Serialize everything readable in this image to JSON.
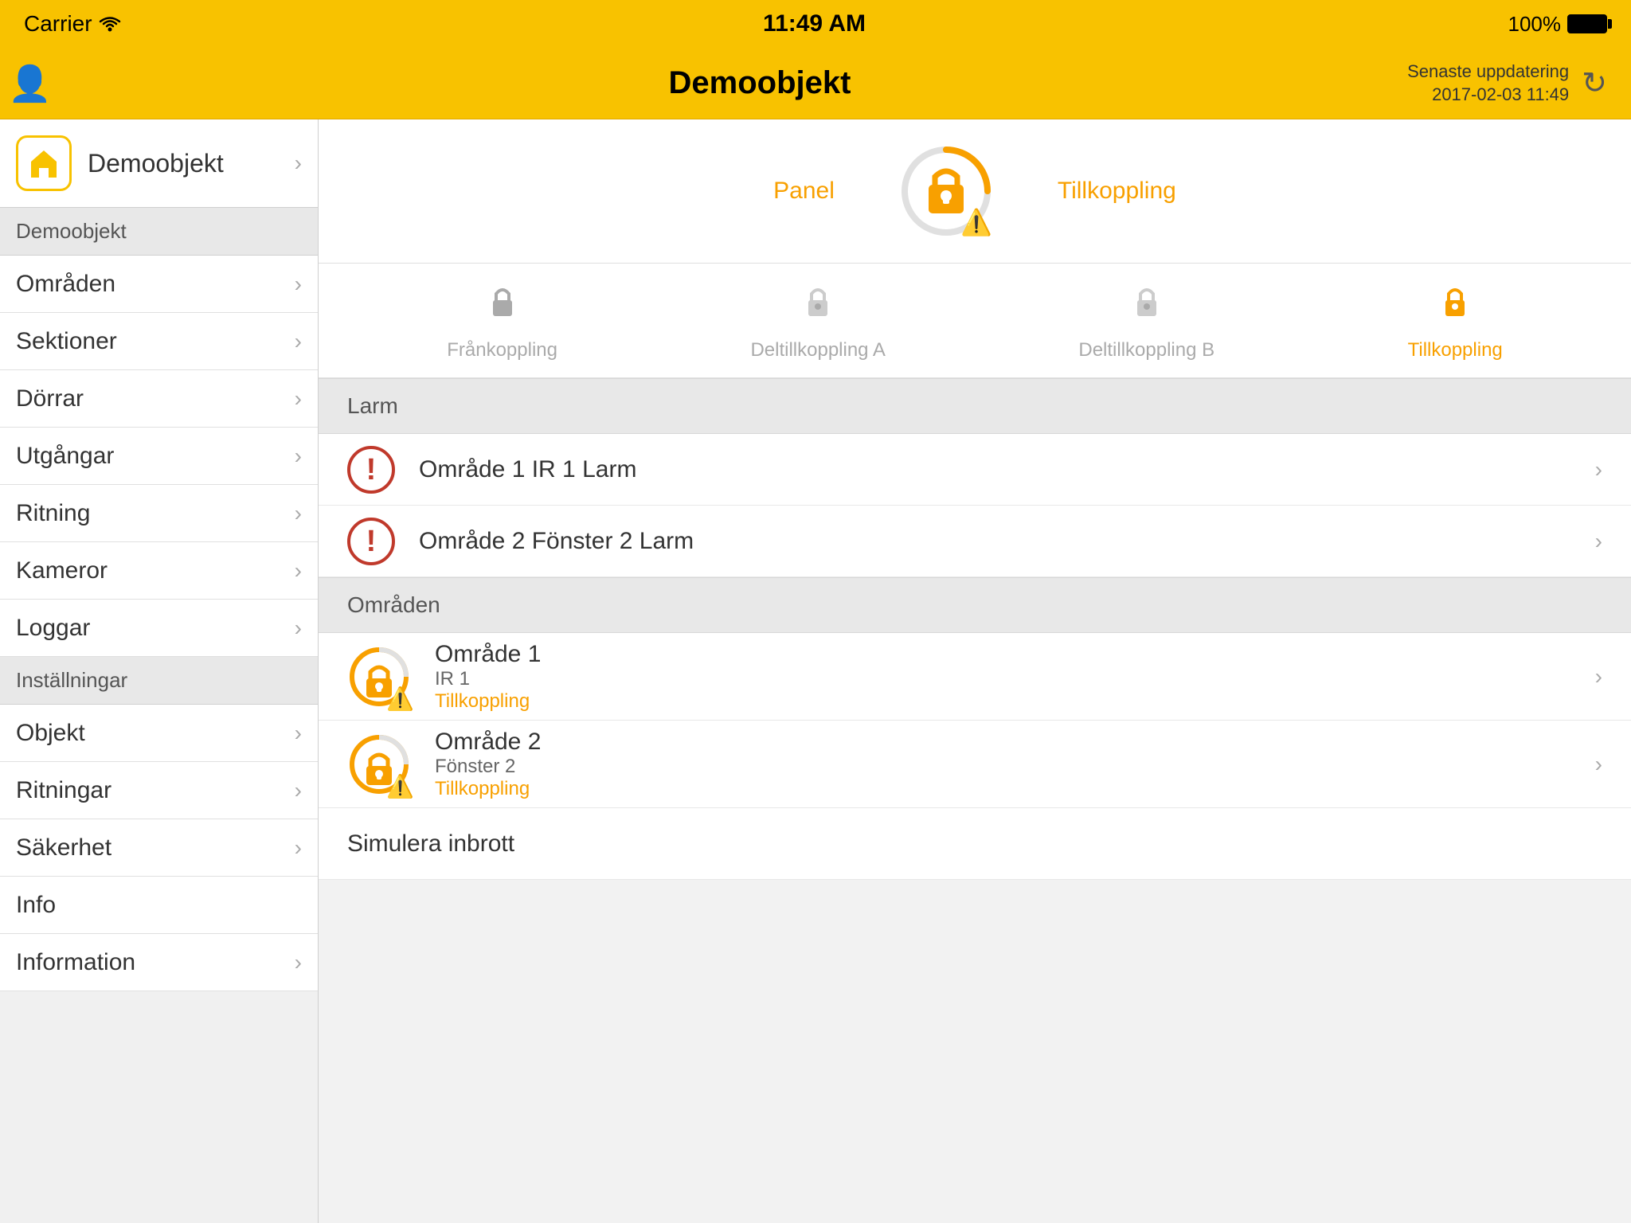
{
  "statusBar": {
    "carrier": "Carrier",
    "time": "11:49 AM",
    "battery": "100%"
  },
  "header": {
    "title": "Demoobjekt",
    "updateLabel": "Senaste uppdatering\n2017-02-03 11:49"
  },
  "sidebar": {
    "headerTitle": "Demoobjekt",
    "sections": [
      {
        "type": "header-item",
        "label": "Demoobjekt",
        "hasChevron": false
      },
      {
        "type": "section",
        "label": "Demoobjekt"
      },
      {
        "type": "item",
        "label": "Områden",
        "hasChevron": true
      },
      {
        "type": "item",
        "label": "Sektioner",
        "hasChevron": true
      },
      {
        "type": "item",
        "label": "Dörrar",
        "hasChevron": true
      },
      {
        "type": "item",
        "label": "Utgångar",
        "hasChevron": true
      },
      {
        "type": "item",
        "label": "Ritning",
        "hasChevron": true
      },
      {
        "type": "item",
        "label": "Kameror",
        "hasChevron": true
      },
      {
        "type": "item",
        "label": "Loggar",
        "hasChevron": true
      },
      {
        "type": "section",
        "label": "Inställningar"
      },
      {
        "type": "item",
        "label": "Objekt",
        "hasChevron": true
      },
      {
        "type": "item",
        "label": "Ritningar",
        "hasChevron": true
      },
      {
        "type": "item",
        "label": "Säkerhet",
        "hasChevron": true
      },
      {
        "type": "item-nochevron",
        "label": "Info",
        "hasChevron": false
      },
      {
        "type": "item",
        "label": "Information",
        "hasChevron": true
      }
    ]
  },
  "panel": {
    "panelLabel": "Panel",
    "tillkopplingLabel": "Tillkoppling"
  },
  "lockOptions": [
    {
      "label": "Frånkoppling",
      "active": false
    },
    {
      "label": "Deltillkoppling A",
      "active": false
    },
    {
      "label": "Deltillkoppling B",
      "active": false
    },
    {
      "label": "Tillkoppling",
      "active": true
    }
  ],
  "alarms": {
    "sectionLabel": "Larm",
    "items": [
      {
        "text": "Område 1 IR 1 Larm"
      },
      {
        "text": "Område 2 Fönster 2 Larm"
      }
    ]
  },
  "areas": {
    "sectionLabel": "Områden",
    "items": [
      {
        "name": "Område 1",
        "sub": "IR 1",
        "status": "Tillkoppling"
      },
      {
        "name": "Område 2",
        "sub": "Fönster 2",
        "status": "Tillkoppling"
      }
    ]
  },
  "simulera": {
    "label": "Simulera inbrott"
  }
}
